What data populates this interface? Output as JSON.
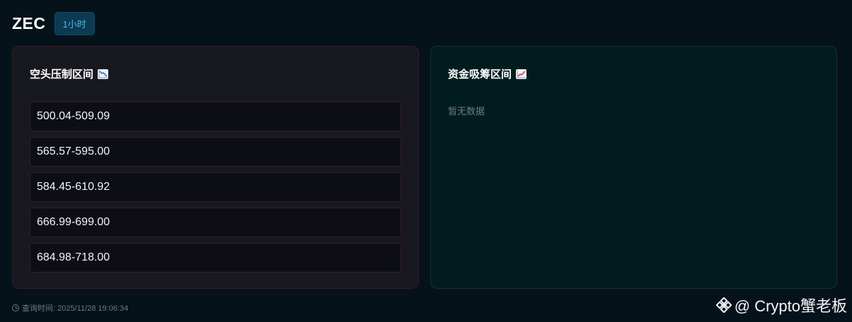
{
  "header": {
    "symbol": "ZEC",
    "timeframe": "1小时"
  },
  "short_panel": {
    "title": "空头压制区间",
    "icon": "chart-decreasing-icon",
    "zones": [
      "500.04-509.09",
      "565.57-595.00",
      "584.45-610.92",
      "666.99-699.00",
      "684.98-718.00"
    ],
    "colors": {
      "background": "#181820",
      "border": "#3a1b22",
      "trend": "#e0405a"
    }
  },
  "accum_panel": {
    "title": "资金吸筹区间",
    "icon": "chart-increasing-icon",
    "empty_text": "暂无数据",
    "colors": {
      "background": "#011c1f",
      "border": "#0f3330",
      "trend": "#e0405a"
    }
  },
  "footer": {
    "query_time": "查询时间: 2025/11/28 19:06:34",
    "icon": "clock-icon"
  },
  "watermark": {
    "text": "@ Crypto蟹老板",
    "icon": "binance-logo-icon"
  }
}
